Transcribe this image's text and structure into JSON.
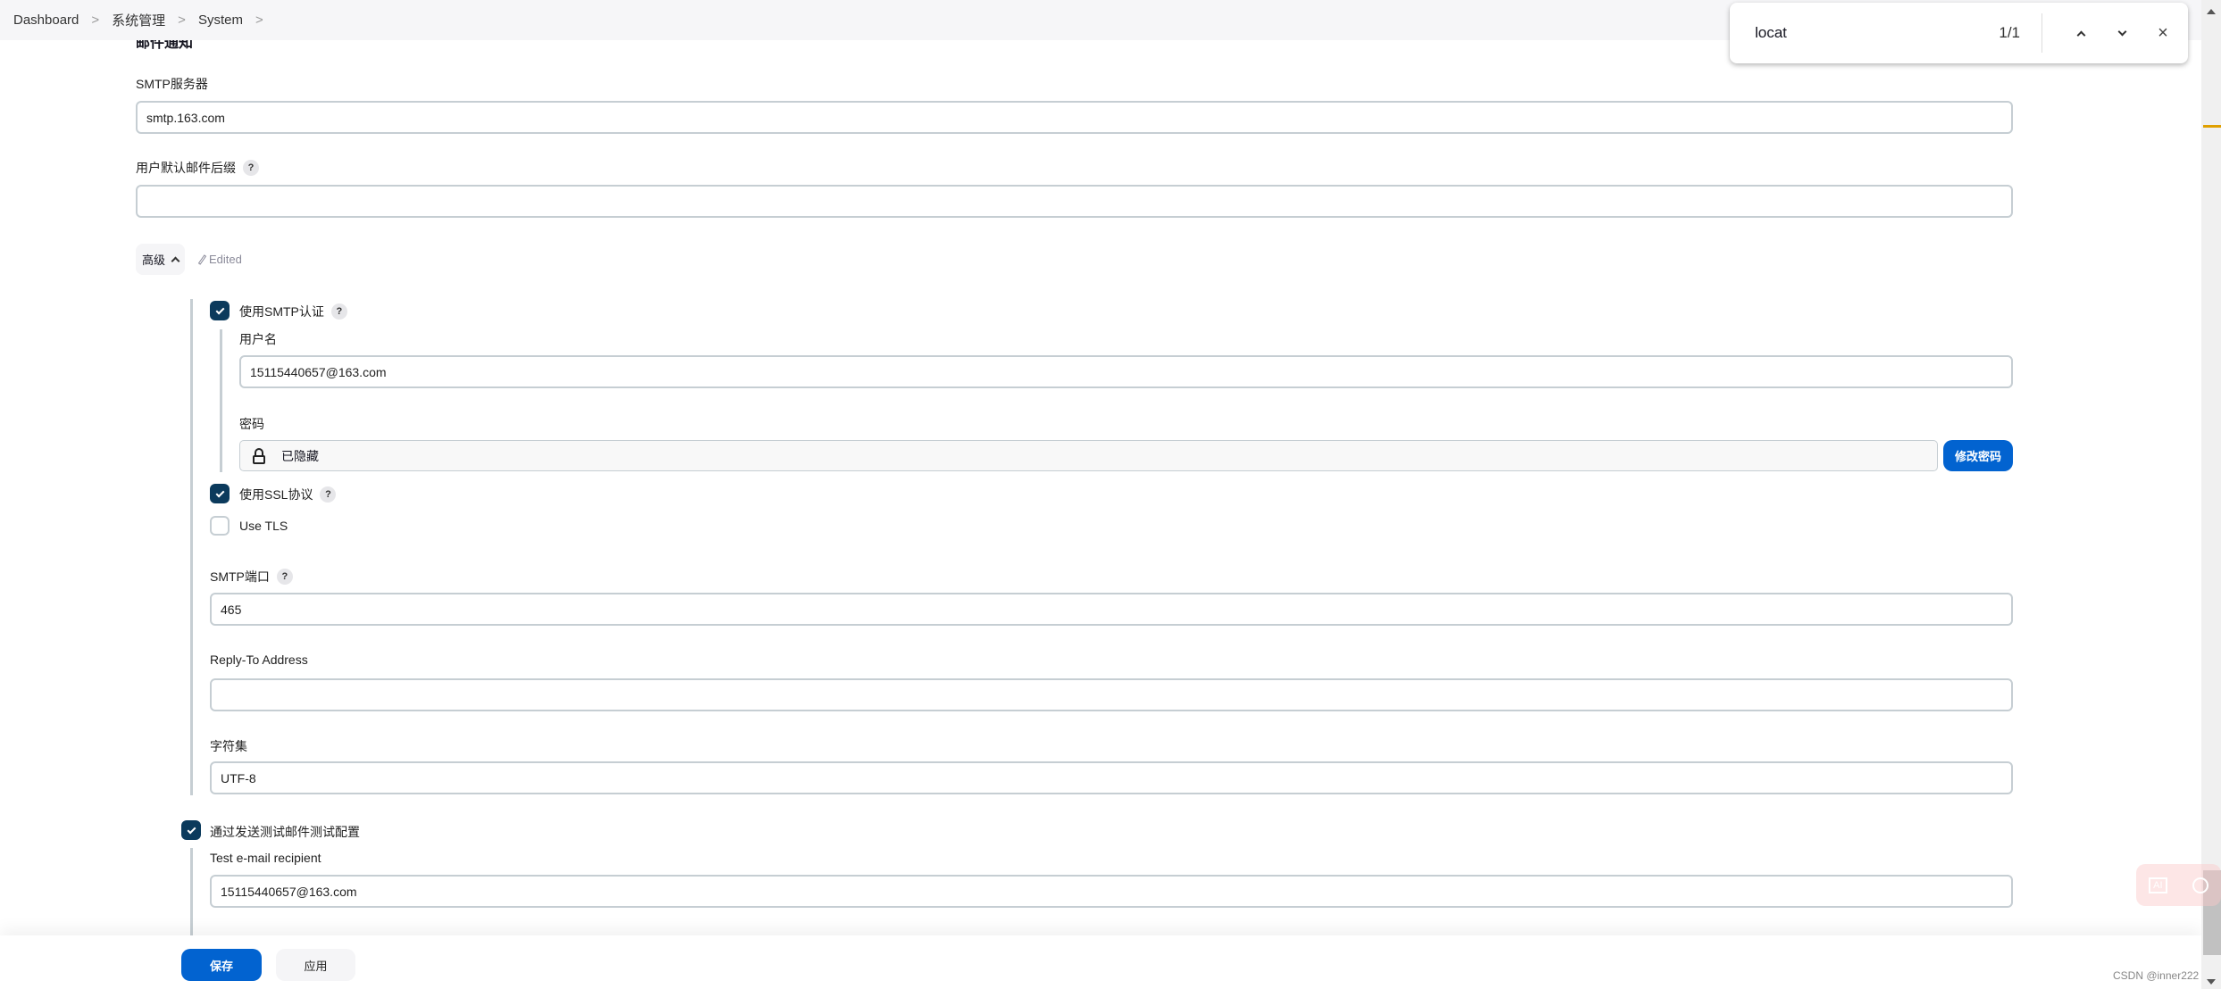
{
  "breadcrumb": [
    "Dashboard",
    "系统管理",
    "System"
  ],
  "section_title": "邮件通知",
  "smtp_server": {
    "label": "SMTP服务器",
    "value": "smtp.163.com"
  },
  "default_suffix": {
    "label": "用户默认邮件后缀",
    "value": ""
  },
  "advanced": {
    "label": "高级",
    "edited": "Edited"
  },
  "use_smtp_auth": {
    "label": "使用SMTP认证",
    "checked": true
  },
  "username": {
    "label": "用户名",
    "value": "15115440657@163.com"
  },
  "password": {
    "label": "密码",
    "value": "已隐藏",
    "change_button": "修改密码"
  },
  "use_ssl": {
    "label": "使用SSL协议",
    "checked": true
  },
  "use_tls": {
    "label": "Use TLS",
    "checked": false
  },
  "smtp_port": {
    "label": "SMTP端口",
    "value": "465"
  },
  "reply_to": {
    "label": "Reply-To Address",
    "value": ""
  },
  "charset": {
    "label": "字符集",
    "value": "UTF-8"
  },
  "test_config": {
    "label": "通过发送测试邮件测试配置",
    "checked": true
  },
  "test_recipient": {
    "label": "Test e-mail recipient",
    "value": "15115440657@163.com"
  },
  "footer": {
    "save": "保存",
    "apply": "应用"
  },
  "find_bar": {
    "query": "locat",
    "count": "1/1"
  },
  "watermark": "CSDN @inner222",
  "colors": {
    "primary": "#0263d0",
    "checkbox": "#0b3a5c"
  }
}
